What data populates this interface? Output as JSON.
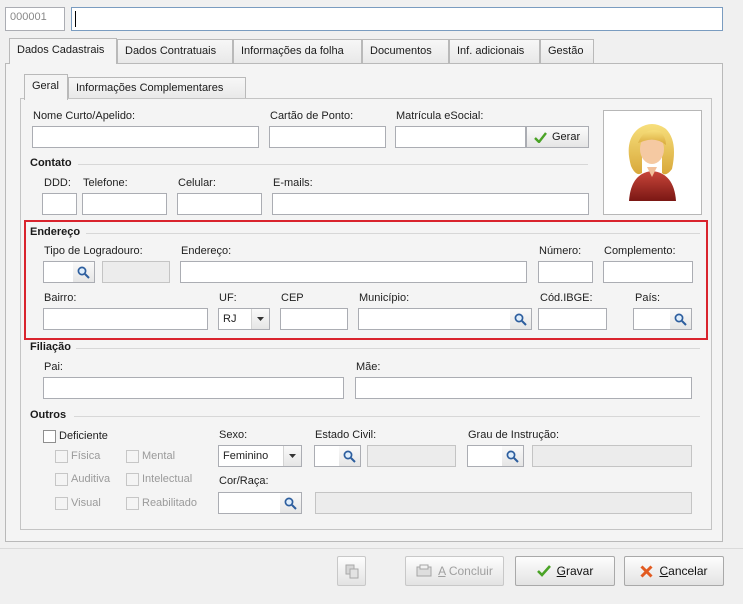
{
  "header": {
    "code_value": "000001",
    "name_value": ""
  },
  "main_tabs": [
    {
      "label": "Dados Cadastrais",
      "mnemonic": "D",
      "active": true
    },
    {
      "label": "Dados Contratuais",
      "mnemonic": "t"
    },
    {
      "label": "Informações da folha",
      "mnemonic": "f"
    },
    {
      "label": "Documentos",
      "mnemonic": "u"
    },
    {
      "label": "Inf. adicionais",
      "mnemonic": "I"
    },
    {
      "label": "Gestão",
      "mnemonic": ""
    }
  ],
  "sub_tabs": [
    {
      "label": "Geral",
      "active": true
    },
    {
      "label": "Informações Complementares"
    }
  ],
  "geral": {
    "nome_label": "Nome Curto/Apelido:",
    "cartao_label": "Cartão de Ponto:",
    "matricula_label": "Matrícula eSocial:",
    "gerar_label": "Gerar"
  },
  "contato": {
    "title": "Contato",
    "ddd_label": "DDD:",
    "telefone_label": "Telefone:",
    "celular_label": "Celular:",
    "emails_label": "E-mails:"
  },
  "endereco": {
    "title": "Endereço",
    "tipo_label": "Tipo de Logradouro:",
    "endereco_label": "Endereço:",
    "numero_label": "Número:",
    "complemento_label": "Complemento:",
    "bairro_label": "Bairro:",
    "uf_label": "UF:",
    "uf_value": "RJ",
    "cep_label": "CEP",
    "municipio_label": "Município:",
    "cod_ibge_label": "Cód.IBGE:",
    "pais_label": "País:",
    "highlight_color": "#d9232d"
  },
  "filiacao": {
    "title": "Filiação",
    "pai_label": "Pai:",
    "mae_label": "Mãe:"
  },
  "outros": {
    "title": "Outros",
    "deficiente_label": "Deficiente",
    "fisica_label": "Física",
    "mental_label": "Mental",
    "auditiva_label": "Auditiva",
    "intelectual_label": "Intelectual",
    "visual_label": "Visual",
    "reabilitado_label": "Reabilitado",
    "sexo_label": "Sexo:",
    "sexo_value": "Feminino",
    "estado_civil_label": "Estado Civil:",
    "grau_label": "Grau de Instrução:",
    "cor_label": "Cor/Raça:"
  },
  "footer": {
    "concluir_pre": "",
    "concluir_mn": "A",
    "concluir_post": " Concluir",
    "gravar_pre": "",
    "gravar_mn": "G",
    "gravar_post": "ravar",
    "cancelar_pre": "",
    "cancelar_mn": "C",
    "cancelar_post": "ancelar"
  },
  "icons": {
    "search": "search-icon",
    "check": "check-icon",
    "close": "close-icon",
    "avatar": "user-avatar-icon",
    "copy": "copy-icon",
    "document": "document-icon",
    "dropdown": "chevron-down-icon"
  }
}
